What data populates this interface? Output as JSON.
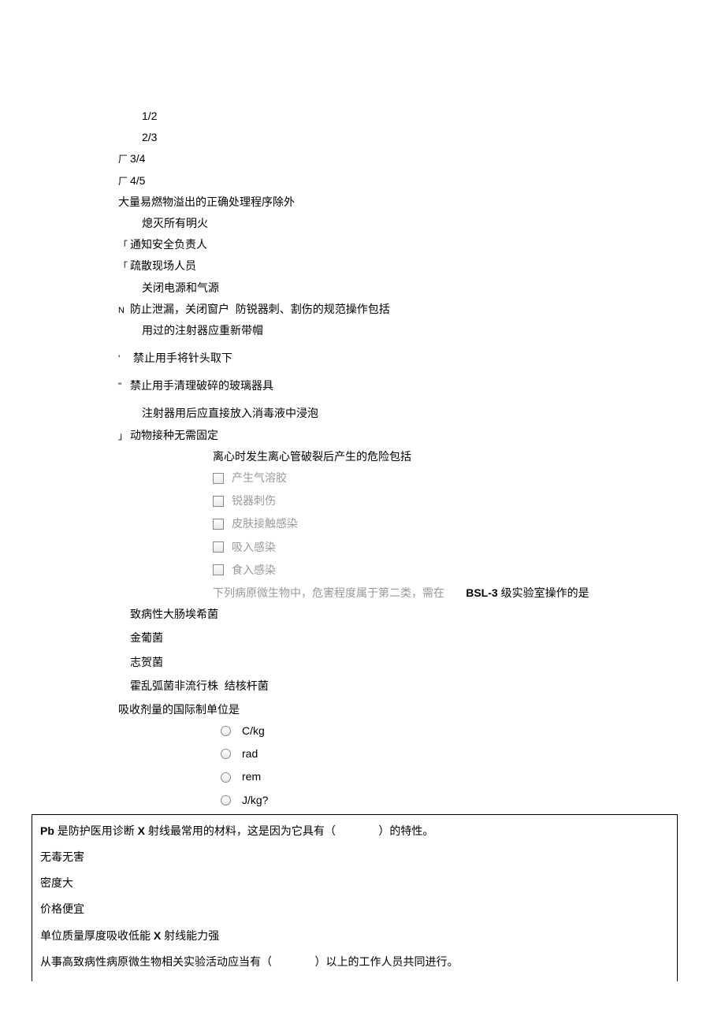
{
  "q1": {
    "options": [
      "1/2",
      "2/3",
      "3/4",
      "4/5"
    ],
    "prefix3": "厂",
    "prefix4": "厂"
  },
  "q2": {
    "stem": "大量易燃物溢出的正确处理程序除外",
    "options": [
      {
        "prefix": "",
        "text": "熄灭所有明火"
      },
      {
        "prefix": "「",
        "text": "通知安全负责人"
      },
      {
        "prefix": "「",
        "text": "疏散现场人员"
      },
      {
        "prefix": "",
        "text": "关闭电源和气源"
      },
      {
        "prefix": "N",
        "text": "防止泄漏，关闭窗户"
      }
    ]
  },
  "q3": {
    "stem": "防锐器刺、割伤的规范操作包括",
    "options": [
      {
        "prefix": "",
        "text": "用过的注射器应重新带帽"
      },
      {
        "prefix": "'",
        "text": "禁止用手将针头取下"
      },
      {
        "prefix": "\"",
        "text": "禁止用手清理破碎的玻璃器具"
      },
      {
        "prefix": "",
        "text": "注射器用后应直接放入消毒液中浸泡"
      },
      {
        "prefix": "」",
        "text": "动物接种无需固定"
      }
    ]
  },
  "q4": {
    "stem": "离心时发生离心管破裂后产生的危险包括",
    "options": [
      "产生气溶胶",
      "锐器刺伤",
      "皮肤接触感染",
      "吸入感染",
      "食入感染"
    ]
  },
  "q5": {
    "stem_part1": "下列病原微生物中，危害程度属于第二类，需在",
    "stem_bold": "BSL-3",
    "stem_part2": "级实验室操作的是",
    "options": [
      "致病性大肠埃希菌",
      "金葡菌",
      "志贺菌",
      "霍乱弧菌非流行株",
      "结核杆菌"
    ]
  },
  "q6": {
    "stem": "吸收剂量的国际制单位是",
    "options": [
      "C/kg",
      "rad",
      "rem",
      "J/kg?"
    ]
  },
  "q7": {
    "stem_part1": "Pb",
    "stem_part2": "是防护医用诊断",
    "stem_part3": "X",
    "stem_part4": "射线最常用的材料，这是因为它具有（",
    "stem_part5": "）的特性。",
    "options": [
      "无毒无害",
      "密度大",
      "价格便宜",
      "单位质量厚度吸收低能",
      "射线能力强"
    ],
    "opt4_x": "X"
  },
  "q8": {
    "stem_part1": "从事高致病性病原微生物相关实验活动应当有（",
    "stem_part2": "）以上的工作人员共同进行。"
  }
}
